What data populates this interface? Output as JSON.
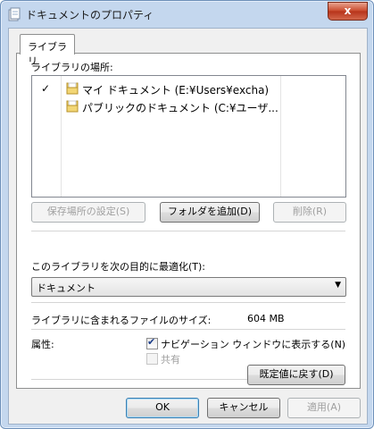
{
  "window": {
    "title": "ドキュメントのプロパティ",
    "close_glyph": "x"
  },
  "tabs": [
    {
      "label": "ライブラリ"
    }
  ],
  "library": {
    "locations_label": "ライブラリの場所:",
    "items": [
      {
        "checked": true,
        "check_glyph": "✓",
        "label": "マイ ドキュメント (E:¥Users¥excha)"
      },
      {
        "checked": false,
        "check_glyph": "",
        "label": "パブリックのドキュメント (C:¥ユーザ..."
      }
    ],
    "set_save_location_label": "保存場所の設定(S)",
    "add_folder_label": "フォルダを追加(D)",
    "remove_label": "削除(R)"
  },
  "optimize": {
    "label": "このライブラリを次の目的に最適化(T):",
    "selected": "ドキュメント",
    "arrow_glyph": "▼"
  },
  "size": {
    "label": "ライブラリに含まれるファイルのサイズ:",
    "value": "604 MB"
  },
  "attributes": {
    "label": "属性:",
    "show_in_nav_label": "ナビゲーション ウィンドウに表示する(N)",
    "show_in_nav_checked": true,
    "shared_label": "共有",
    "shared_checked": false
  },
  "restore_defaults_label": "既定値に戻す(D)",
  "footer": {
    "ok_label": "OK",
    "cancel_label": "キャンセル",
    "apply_label": "適用(A)"
  }
}
